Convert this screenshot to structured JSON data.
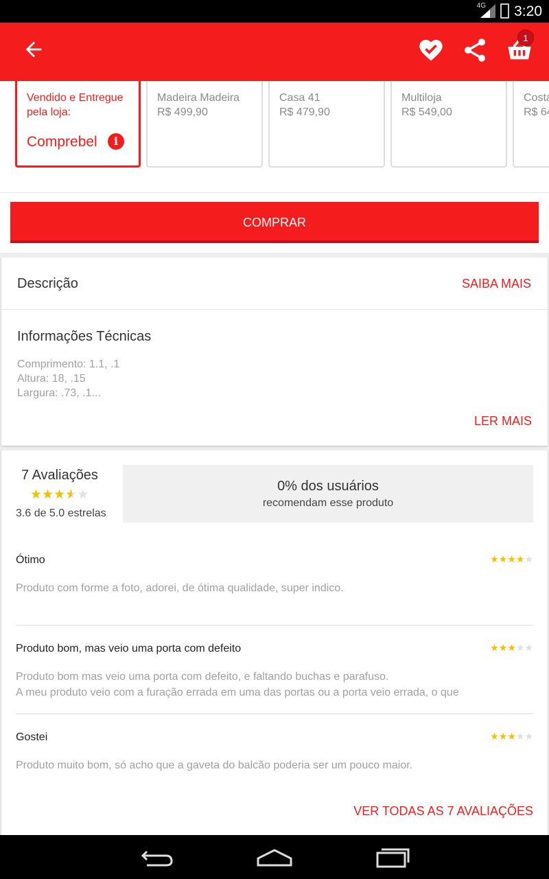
{
  "status_bar": {
    "network": "4G",
    "time": "3:20"
  },
  "app_bar": {
    "cart_count": "1"
  },
  "sellers": [
    {
      "title": "Vendido e Entregue pela loja:",
      "name": "Comprebel",
      "price": "",
      "active": true
    },
    {
      "name": "Madeira Madeira",
      "price": "R$ 499,90"
    },
    {
      "name": "Casa 41",
      "price": "R$ 479,90"
    },
    {
      "name": "Multiloja",
      "price": "R$ 549,00"
    },
    {
      "name": "Costa",
      "price": "R$ 64"
    }
  ],
  "buy_button": "COMPRAR",
  "description": {
    "title": "Descrição",
    "link": "SAIBA MAIS",
    "tech_title": "Informações Técnicas",
    "tech_lines": [
      "Comprimento: 1.1, .1",
      "Altura: 18, .15",
      "Largura: .73, .1..."
    ],
    "read_more": "LER MAIS"
  },
  "reviews": {
    "count_label": "7 Avaliações",
    "rating": 3.6,
    "rating_label": "3.6 de 5.0 estrelas",
    "recommend_pct": "0% dos usuários",
    "recommend_sub": "recomendam esse produto",
    "items": [
      {
        "title": "Ótimo",
        "stars": 4,
        "text": "Produto com forme a foto, adorei, de ótima qualidade, super indico."
      },
      {
        "title": "Produto bom, mas veio uma porta com defeito",
        "stars": 3,
        "text": "Produto bom mas veio uma porta com defeito, e faltando buchas e parafuso.",
        "text2": "A meu produto veio com a furação errada em uma das portas ou a porta veio errada, o que"
      },
      {
        "title": "Gostei",
        "stars": 3,
        "text": "Produto muito bom, só acho que a gaveta do balcão poderia ser um pouco maior."
      }
    ],
    "see_all": "VER TODAS AS 7 AVALIAÇÕES"
  },
  "colors": {
    "accent": "#f41c1c",
    "accent_dark": "#c4101a",
    "star": "#f6c000"
  },
  "icons": [
    "arrow-back-icon",
    "heart-check-icon",
    "share-icon",
    "basket-icon",
    "info-icon",
    "star-icon",
    "nav-back-icon",
    "nav-home-icon",
    "nav-recents-icon"
  ]
}
